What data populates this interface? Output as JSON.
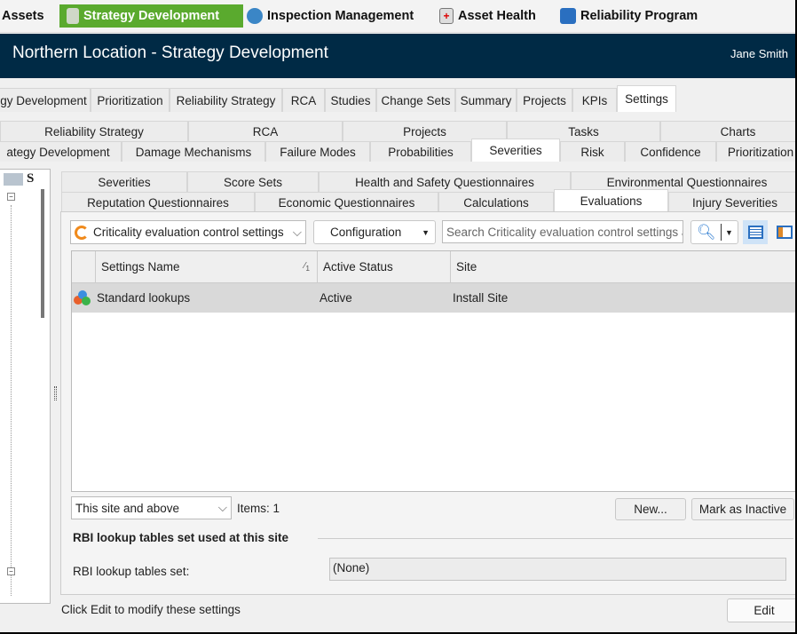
{
  "topnav": {
    "items": [
      {
        "label": "Assets",
        "icon": "none"
      },
      {
        "label": "Strategy Development",
        "icon": "document-icon",
        "active": true
      },
      {
        "label": "Inspection Management",
        "icon": "gauge-icon"
      },
      {
        "label": "Asset Health",
        "icon": "health-icon"
      },
      {
        "label": "Reliability Program",
        "icon": "folder-icon"
      }
    ]
  },
  "header": {
    "title": "Northern Location - Strategy Development",
    "user": "Jane Smith"
  },
  "main_tabs": [
    "gy Development",
    "Prioritization",
    "Reliability Strategy",
    "RCA",
    "Studies",
    "Change Sets",
    "Summary",
    "Projects",
    "KPIs",
    "Settings"
  ],
  "main_tab_active": "Settings",
  "settings_tabs_row1": [
    "Reliability Strategy",
    "RCA",
    "Projects",
    "Tasks",
    "Charts"
  ],
  "settings_tabs_row2": [
    "ategy Development",
    "Damage Mechanisms",
    "Failure Modes",
    "Probabilities",
    "Severities",
    "Risk",
    "Confidence",
    "Prioritization"
  ],
  "settings_tab_active": "Severities",
  "tree": {
    "header": "S"
  },
  "severity_tabs_row1": [
    "Severities",
    "Score Sets",
    "Health and Safety Questionnaires",
    "Environmental Questionnaires"
  ],
  "severity_tabs_row2": [
    "Reputation Questionnaires",
    "Economic Questionnaires",
    "Calculations",
    "Evaluations",
    "Injury Severities"
  ],
  "severity_tab_active": "Evaluations",
  "toolbar": {
    "type_select": "Criticality evaluation control settings",
    "configuration": "Configuration",
    "search_placeholder": "Search Criticality evaluation control settings and"
  },
  "grid": {
    "columns": [
      "Settings Name",
      "Active Status",
      "Site"
    ],
    "sort_indicator": "1",
    "rows": [
      {
        "name": "Standard lookups",
        "status": "Active",
        "site": "Install Site"
      }
    ]
  },
  "bottom": {
    "scope_select": "This site and above",
    "items_count": "Items: 1",
    "new": "New...",
    "mark_inactive": "Mark as Inactive"
  },
  "rbi": {
    "group_title": "RBI lookup tables set used at this site",
    "label": "RBI lookup tables set:",
    "value": "(None)"
  },
  "footer": {
    "status": "Click Edit to modify these settings",
    "edit": "Edit"
  },
  "colors": {
    "accent_green": "#5aaa2e",
    "header_bg": "#002a45"
  }
}
